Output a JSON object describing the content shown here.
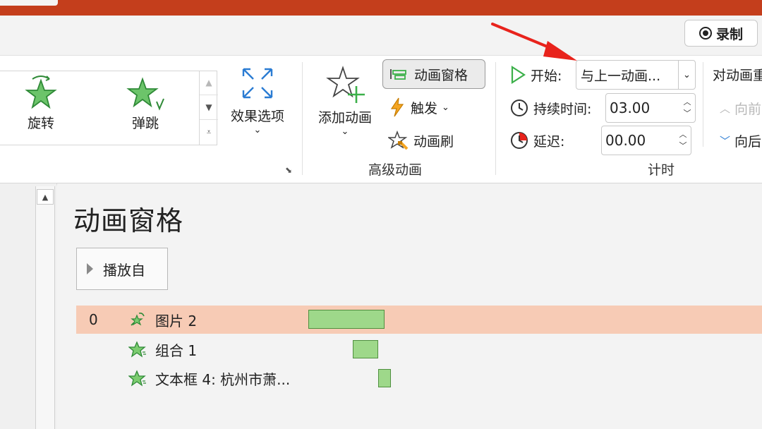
{
  "toolbar": {
    "record_label": "录制"
  },
  "ribbon": {
    "gallery": {
      "items": [
        {
          "label": "旋转",
          "icon": "spin-star-icon"
        },
        {
          "label": "弹跳",
          "icon": "bounce-star-icon"
        }
      ]
    },
    "effect_options_label": "效果选项",
    "advanced_animation": {
      "group_label": "高级动画",
      "add_animation_label": "添加动画",
      "animation_pane_label": "动画窗格",
      "trigger_label": "触发",
      "animation_painter_label": "动画刷"
    },
    "timing": {
      "group_label": "计时",
      "start_label": "开始:",
      "start_value": "与上一动画...",
      "duration_label": "持续时间:",
      "duration_value": "03.00",
      "delay_label": "延迟:",
      "delay_value": "00.00"
    },
    "reorder": {
      "title": "对动画重",
      "move_earlier_label": "向前",
      "move_later_label": "向后"
    }
  },
  "colors": {
    "title_bar": "#c43e1c",
    "selected_row": "#f7cbb5",
    "timeline_bar": "#9ed88a",
    "accent_green": "#3cb04a",
    "arrow_red": "#e8231c"
  },
  "animation_pane": {
    "title": "动画窗格",
    "play_button_label": "播放自",
    "items": [
      {
        "number": "0",
        "label": "图片 2",
        "selected": true
      },
      {
        "number": "",
        "label": "组合 1",
        "selected": false
      },
      {
        "number": "",
        "label": "文本框 4: 杭州市萧...",
        "selected": false
      }
    ]
  }
}
